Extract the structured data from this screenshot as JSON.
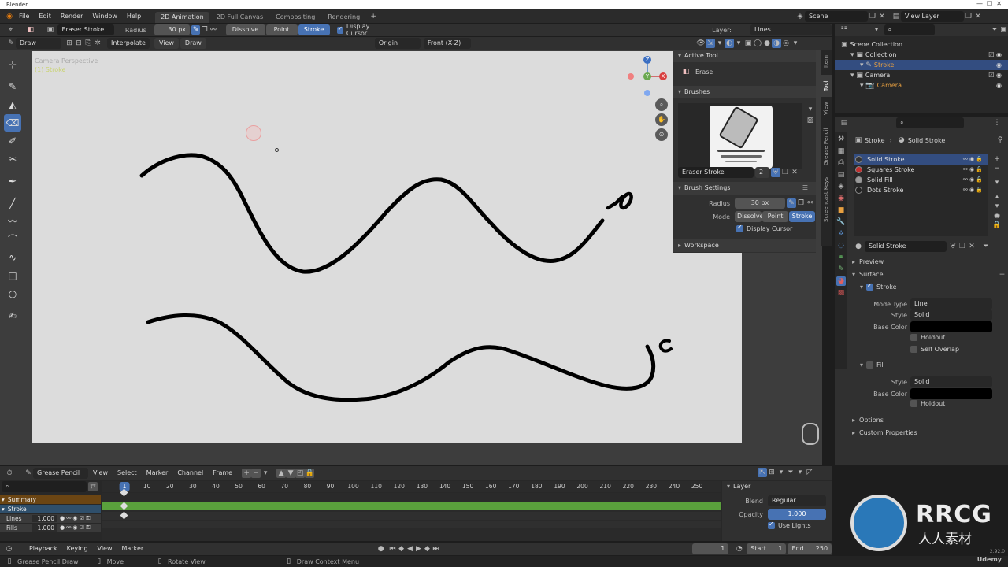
{
  "title_bar": {
    "app": "Blender"
  },
  "menu": [
    "File",
    "Edit",
    "Render",
    "Window",
    "Help"
  ],
  "workspaces": [
    "2D Animation",
    "2D Full Canvas",
    "Compositing",
    "Rendering"
  ],
  "add_tab_icon": "plus-icon",
  "scene": {
    "label": "Scene",
    "view_layer": "View Layer"
  },
  "header": {
    "tool_name": "Eraser Stroke",
    "radius_label": "Radius",
    "radius_value": "30 px",
    "modes": [
      "Dissolve",
      "Point",
      "Stroke"
    ],
    "display_cursor": "Display Cursor",
    "layer_label": "Layer:",
    "layer_value": "Lines"
  },
  "viewport_header": {
    "mode": "Draw",
    "interpolate": "Interpolate",
    "view": "View",
    "draw": "Draw",
    "origin": "Origin",
    "plane": "Front (X-Z)"
  },
  "viewport": {
    "overlay_line1": "Camera Perspective",
    "overlay_line2": "(1) Stroke",
    "gizmo_axes": {
      "z": "Z",
      "x": "X",
      "y": "Y"
    }
  },
  "sidebar_tabs": [
    "Item",
    "Tool",
    "View",
    "Grease Pencil",
    "Screencast Keys"
  ],
  "tool_panel": {
    "active_tool_title": "Active Tool",
    "active_tool_name": "Erase",
    "brushes_title": "Brushes",
    "brush_name": "Eraser Stroke",
    "brush_users": "2",
    "brush_settings_title": "Brush Settings",
    "radius_label": "Radius",
    "radius_value": "30 px",
    "mode_label": "Mode",
    "modes": [
      "Dissolve",
      "Point",
      "Stroke"
    ],
    "display_cursor": "Display Cursor",
    "workspace_title": "Workspace"
  },
  "outliner": {
    "items": [
      {
        "label": "Scene Collection",
        "indent": 0
      },
      {
        "label": "Collection",
        "indent": 1
      },
      {
        "label": "Stroke",
        "indent": 2,
        "selected": true
      },
      {
        "label": "Camera",
        "indent": 1
      },
      {
        "label": "Camera",
        "indent": 2
      }
    ]
  },
  "properties": {
    "breadcrumb_object": "Stroke",
    "breadcrumb_material": "Solid Stroke",
    "materials": [
      "Solid Stroke",
      "Squares Stroke",
      "Solid Fill",
      "Dots Stroke"
    ],
    "material_field": "Solid Stroke",
    "sections": {
      "preview": "Preview",
      "surface": "Surface",
      "stroke": "Stroke",
      "mode_type_label": "Mode Type",
      "mode_type_value": "Line",
      "style_label": "Style",
      "style_value": "Solid",
      "base_color_label": "Base Color",
      "holdout": "Holdout",
      "self_overlap": "Self Overlap",
      "fill": "Fill",
      "fill_style_label": "Style",
      "fill_style_value": "Solid",
      "fill_base_color_label": "Base Color",
      "fill_holdout": "Holdout",
      "options": "Options",
      "custom_properties": "Custom Properties"
    },
    "colors": {
      "stroke_color": "#000000",
      "fill_color": "#000000"
    }
  },
  "dopesheet": {
    "mode": "Grease Pencil",
    "menus": [
      "View",
      "Select",
      "Marker",
      "Channel",
      "Frame"
    ],
    "frames": [
      "1",
      "10",
      "20",
      "30",
      "40",
      "50",
      "60",
      "70",
      "80",
      "90",
      "100",
      "110",
      "120",
      "130",
      "140",
      "150",
      "160",
      "170",
      "180",
      "190",
      "200",
      "210",
      "220",
      "230",
      "240",
      "250"
    ],
    "channels": [
      {
        "label": "Summary"
      },
      {
        "label": "Stroke"
      },
      {
        "label": "Lines",
        "value": "1.000"
      },
      {
        "label": "Fills",
        "value": "1.000"
      }
    ],
    "layer_panel": {
      "title": "Layer",
      "blend_label": "Blend",
      "blend_value": "Regular",
      "opacity_label": "Opacity",
      "opacity_value": "1.000",
      "use_lights": "Use Lights"
    }
  },
  "timeline": {
    "menus": [
      "Playback",
      "Keying",
      "View",
      "Marker"
    ],
    "current_frame": "1",
    "start_label": "Start",
    "start_value": "1",
    "end_label": "End",
    "end_value": "250"
  },
  "status_bar": {
    "items": [
      "Grease Pencil Draw",
      "Move",
      "Rotate View",
      "Draw Context Menu"
    ],
    "version": "2.92.0"
  },
  "watermarks": {
    "brand_text": "RRCG",
    "brand_sub": "人人素材",
    "udemy": "Udemy"
  }
}
